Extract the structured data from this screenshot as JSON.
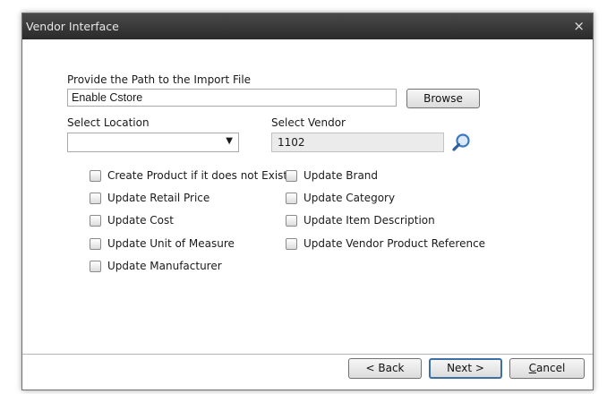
{
  "window": {
    "title": "Vendor Interface",
    "close_glyph": "×"
  },
  "import": {
    "path_label": "Provide the Path to the Import File",
    "path_value": "Enable Cstore",
    "browse_label": "Browse"
  },
  "location": {
    "label": "Select Location",
    "selected_value": "",
    "arrow_glyph": "▼"
  },
  "vendor": {
    "label": "Select Vendor",
    "value": "1102",
    "search_icon": "magnifier-icon"
  },
  "options_left": [
    {
      "label": "Create Product if it does not Exist",
      "checked": false
    },
    {
      "label": "Update Retail Price",
      "checked": false
    },
    {
      "label": "Update Cost",
      "checked": false
    },
    {
      "label": "Update Unit of Measure",
      "checked": false
    },
    {
      "label": "Update Manufacturer",
      "checked": false
    }
  ],
  "options_right": [
    {
      "label": "Update Brand",
      "checked": false
    },
    {
      "label": "Update Category",
      "checked": false
    },
    {
      "label": "Update Item Description",
      "checked": false
    },
    {
      "label": "Update Vendor Product Reference",
      "checked": false
    }
  ],
  "footer": {
    "back_label": "< Back",
    "next_label": "Next >",
    "cancel_first": "C",
    "cancel_rest": "ancel"
  },
  "colors": {
    "title_bar": "#333333",
    "default_button_border": "#3d6fa6",
    "icon_blue": "#3a78c2"
  }
}
